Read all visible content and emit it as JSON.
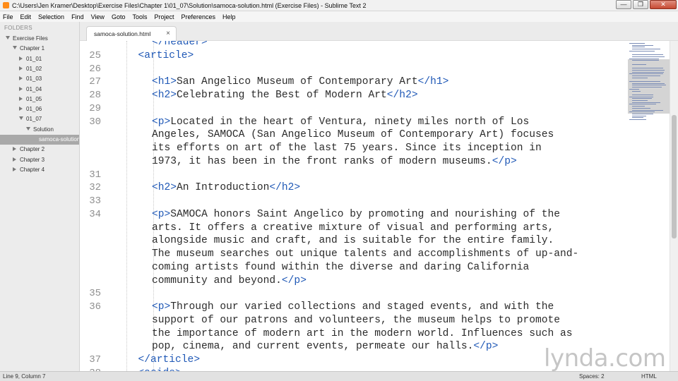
{
  "window": {
    "title": "C:\\Users\\Jen Kramer\\Desktop\\Exercise Files\\Chapter 1\\01_07\\Solution\\samoca-solution.html (Exercise Files) - Sublime Text 2",
    "minimize_label": "—",
    "maximize_label": "❐",
    "close_label": "✕"
  },
  "menu": [
    "File",
    "Edit",
    "Selection",
    "Find",
    "View",
    "Goto",
    "Tools",
    "Project",
    "Preferences",
    "Help"
  ],
  "sidebar": {
    "header": "FOLDERS",
    "items": [
      {
        "label": "Exercise Files",
        "state": "open",
        "level": 0
      },
      {
        "label": "Chapter 1",
        "state": "open",
        "level": 1
      },
      {
        "label": "01_01",
        "state": "closed",
        "level": 2
      },
      {
        "label": "01_02",
        "state": "closed",
        "level": 2
      },
      {
        "label": "01_03",
        "state": "closed",
        "level": 2
      },
      {
        "label": "01_04",
        "state": "closed",
        "level": 2
      },
      {
        "label": "01_05",
        "state": "closed",
        "level": 2
      },
      {
        "label": "01_06",
        "state": "closed",
        "level": 2
      },
      {
        "label": "01_07",
        "state": "open",
        "level": 2
      },
      {
        "label": "Solution",
        "state": "open",
        "level": 3
      },
      {
        "label": "samoca-solution.html",
        "state": "file",
        "level": 4,
        "selected": true
      },
      {
        "label": "Chapter 2",
        "state": "closed",
        "level": 1
      },
      {
        "label": "Chapter 3",
        "state": "closed",
        "level": 1
      },
      {
        "label": "Chapter 4",
        "state": "closed",
        "level": 1
      }
    ]
  },
  "tab": {
    "label": "samoca-solution.html",
    "close": "×"
  },
  "editor": {
    "lines": [
      {
        "n": "",
        "indent": 2,
        "parts": [
          [
            "tag",
            "</header>"
          ]
        ],
        "partial": true
      },
      {
        "n": "25",
        "indent": 1,
        "parts": [
          [
            "tag",
            "<article>"
          ]
        ]
      },
      {
        "n": "26",
        "indent": 0,
        "parts": []
      },
      {
        "n": "27",
        "indent": 2,
        "parts": [
          [
            "tag",
            "<h1>"
          ],
          [
            "text",
            "San Angelico Museum of Contemporary Art"
          ],
          [
            "tag",
            "</h1>"
          ]
        ]
      },
      {
        "n": "28",
        "indent": 2,
        "parts": [
          [
            "tag",
            "<h2>"
          ],
          [
            "text",
            "Celebrating the Best of Modern Art"
          ],
          [
            "tag",
            "</h2>"
          ]
        ]
      },
      {
        "n": "29",
        "indent": 0,
        "parts": []
      },
      {
        "n": "30",
        "indent": 2,
        "parts": [
          [
            "tag",
            "<p>"
          ],
          [
            "text",
            "Located in the heart of Ventura, ninety miles north of Los"
          ]
        ]
      },
      {
        "n": "",
        "indent": 2,
        "parts": [
          [
            "text",
            "Angeles, SAMOCA (San Angelico Museum of Contemporary Art) focuses"
          ]
        ]
      },
      {
        "n": "",
        "indent": 2,
        "parts": [
          [
            "text",
            "its efforts on art of the last 75 years. Since its inception in"
          ]
        ]
      },
      {
        "n": "",
        "indent": 2,
        "parts": [
          [
            "text",
            "1973, it has been in the front ranks of modern museums."
          ],
          [
            "tag",
            "</p>"
          ]
        ]
      },
      {
        "n": "31",
        "indent": 0,
        "parts": []
      },
      {
        "n": "32",
        "indent": 2,
        "parts": [
          [
            "tag",
            "<h2>"
          ],
          [
            "text",
            "An Introduction"
          ],
          [
            "tag",
            "</h2>"
          ]
        ]
      },
      {
        "n": "33",
        "indent": 0,
        "parts": []
      },
      {
        "n": "34",
        "indent": 2,
        "parts": [
          [
            "tag",
            "<p>"
          ],
          [
            "text",
            "SAMOCA honors Saint Angelico by promoting and nourishing of the"
          ]
        ]
      },
      {
        "n": "",
        "indent": 2,
        "parts": [
          [
            "text",
            "arts. It offers a creative mixture of visual and performing arts,"
          ]
        ]
      },
      {
        "n": "",
        "indent": 2,
        "parts": [
          [
            "text",
            "alongside music and craft, and is suitable for the entire family."
          ]
        ]
      },
      {
        "n": "",
        "indent": 2,
        "parts": [
          [
            "text",
            "The museum searches out unique talents and accomplishments of up-and-"
          ]
        ]
      },
      {
        "n": "",
        "indent": 2,
        "parts": [
          [
            "text",
            "coming artists found within the diverse and daring California"
          ]
        ]
      },
      {
        "n": "",
        "indent": 2,
        "parts": [
          [
            "text",
            "community and beyond."
          ],
          [
            "tag",
            "</p>"
          ]
        ]
      },
      {
        "n": "35",
        "indent": 0,
        "parts": []
      },
      {
        "n": "36",
        "indent": 2,
        "parts": [
          [
            "tag",
            "<p>"
          ],
          [
            "text",
            "Through our varied collections and staged events, and with the"
          ]
        ]
      },
      {
        "n": "",
        "indent": 2,
        "parts": [
          [
            "text",
            "support of our patrons and volunteers, the museum helps to promote"
          ]
        ]
      },
      {
        "n": "",
        "indent": 2,
        "parts": [
          [
            "text",
            "the importance of modern art in the modern world. Influences such as"
          ]
        ]
      },
      {
        "n": "",
        "indent": 2,
        "parts": [
          [
            "text",
            "pop, cinema, and current events, permeate our halls."
          ],
          [
            "tag",
            "</p>"
          ]
        ]
      },
      {
        "n": "37",
        "indent": 1,
        "parts": [
          [
            "tag",
            "</article>"
          ]
        ]
      },
      {
        "n": "38",
        "indent": 1,
        "parts": [
          [
            "tag",
            "<aside>"
          ]
        ]
      }
    ]
  },
  "statusbar": {
    "position": "Line 9, Column 7",
    "spaces": "Spaces: 2",
    "syntax": "HTML"
  },
  "watermark": "lynda.com",
  "colors": {
    "tag": "#1f58b6",
    "text": "#2b2b2b",
    "line_number": "#8f8f8f",
    "sidebar_selected": "#a9a9a9"
  }
}
